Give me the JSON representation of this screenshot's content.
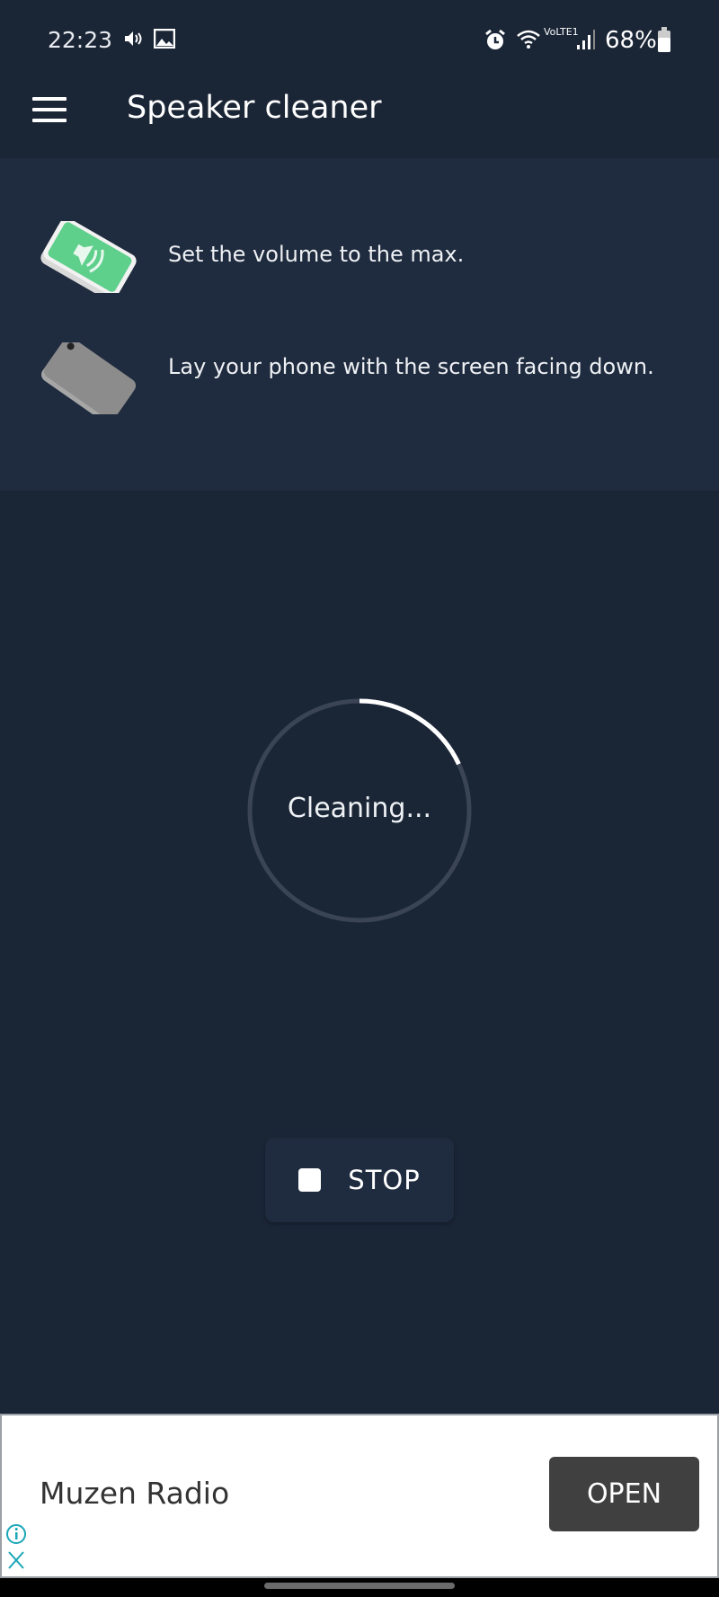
{
  "status_bar": {
    "time": "22:23",
    "battery": "68%",
    "network": "VoLTE1"
  },
  "toolbar": {
    "title": "Speaker cleaner",
    "menu_icon": "hamburger-icon"
  },
  "instructions": [
    {
      "text": "Set the volume to the max.",
      "icon": "phone-speaker-icon"
    },
    {
      "text": "Lay your phone with the screen facing down.",
      "icon": "phone-face-down-icon"
    }
  ],
  "progress": {
    "label": "Cleaning...",
    "fraction": 0.18,
    "track_color": "#3a4454",
    "fill_color": "#ffffff"
  },
  "stop_button": {
    "label": "STOP"
  },
  "ad": {
    "title": "Muzen Radio",
    "cta": "OPEN"
  },
  "colors": {
    "background": "#1a2536",
    "card": "#1f2b3e",
    "accent_green": "#5fcf8c"
  }
}
